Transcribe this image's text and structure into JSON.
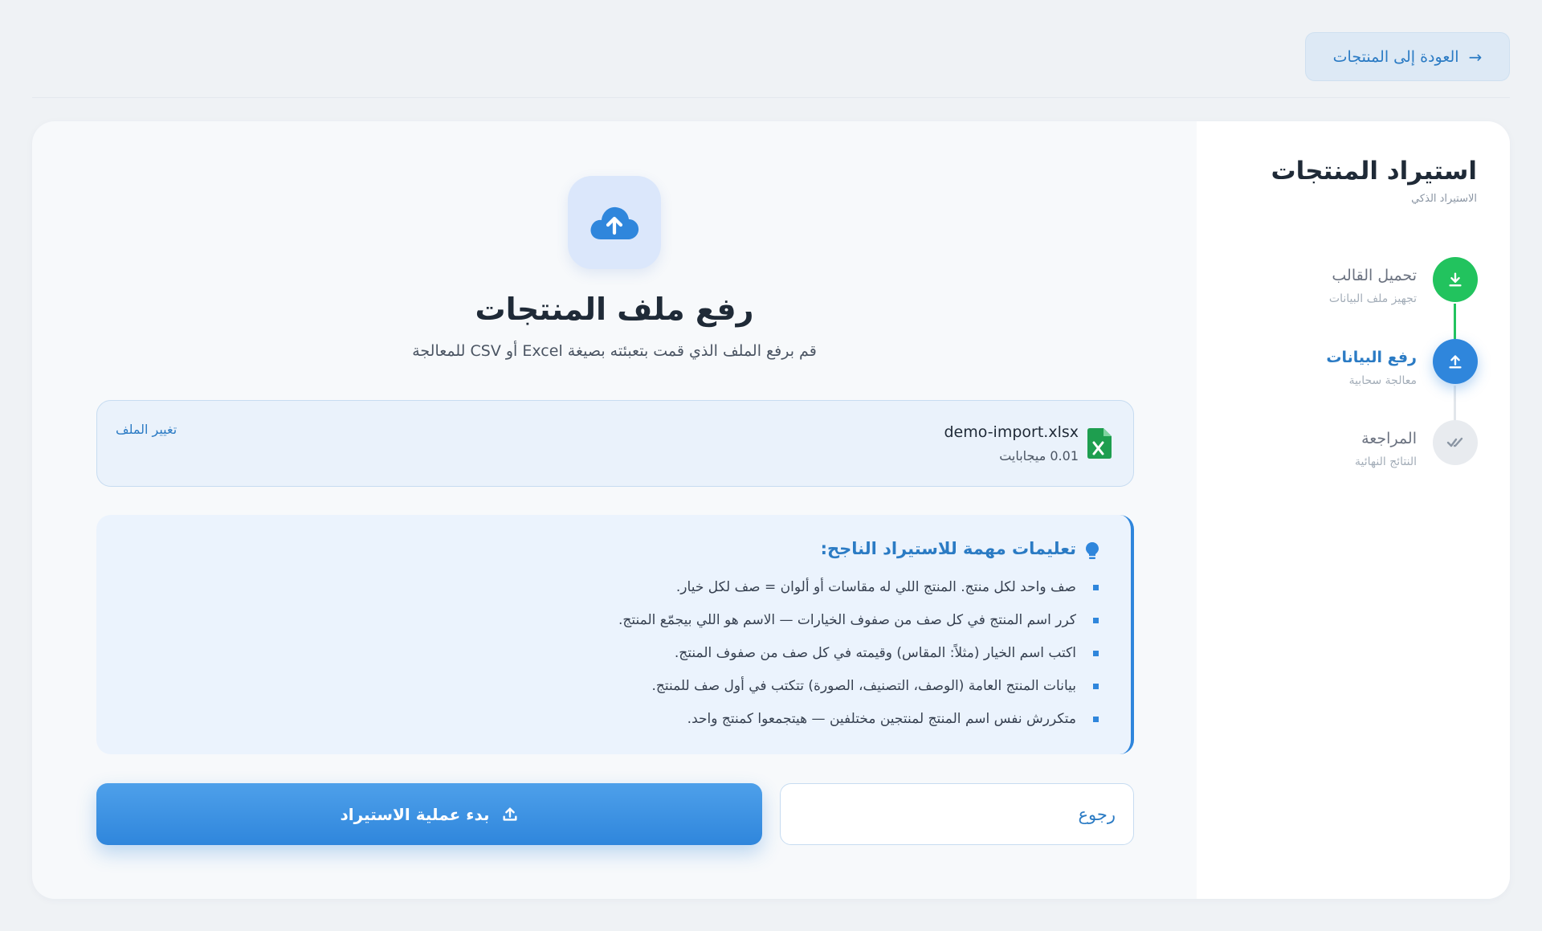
{
  "header": {
    "back_label": "العودة إلى المنتجات",
    "back_icon": "arrow-right-icon"
  },
  "sidebar": {
    "title": "استيراد المنتجات",
    "subtitle": "الاستيراد الذكي",
    "steps": [
      {
        "label": "تحميل القالب",
        "sub": "تجهيز ملف البيانات",
        "status": "done",
        "icon": "download-icon"
      },
      {
        "label": "رفع البيانات",
        "sub": "معالجة سحابية",
        "status": "active",
        "icon": "upload-icon"
      },
      {
        "label": "المراجعة",
        "sub": "النتائج النهائية",
        "status": "pending",
        "icon": "check-double-icon"
      }
    ]
  },
  "main": {
    "title": "رفع ملف المنتجات",
    "subtitle": "قم برفع الملف الذي قمت بتعبئته بصيغة Excel أو CSV للمعالجة",
    "file": {
      "name": "demo-import.xlsx",
      "size": "0.01 ميجابايت",
      "change_label": "تغيير الملف"
    },
    "instructions": {
      "title": "تعليمات مهمة للاستيراد الناجح:",
      "items": [
        "صف واحد لكل منتج. المنتج اللي له مقاسات أو ألوان = صف لكل خيار.",
        "كرر اسم المنتج في كل صف من صفوف الخيارات — الاسم هو اللي بيجمّع المنتج.",
        "اكتب اسم الخيار (مثلاً: المقاس) وقيمته في كل صف من صفوف المنتج.",
        "بيانات المنتج العامة (الوصف، التصنيف، الصورة) تتكتب في أول صف للمنتج.",
        "متكررش نفس اسم المنتج لمنتجين مختلفين — هيتجمعوا كمنتج واحد."
      ]
    },
    "buttons": {
      "back": "رجوع",
      "start": "بدء عملية الاستيراد"
    }
  },
  "colors": {
    "accent": "#2f86dc",
    "success": "#22c35e",
    "background": "#eff2f5"
  }
}
